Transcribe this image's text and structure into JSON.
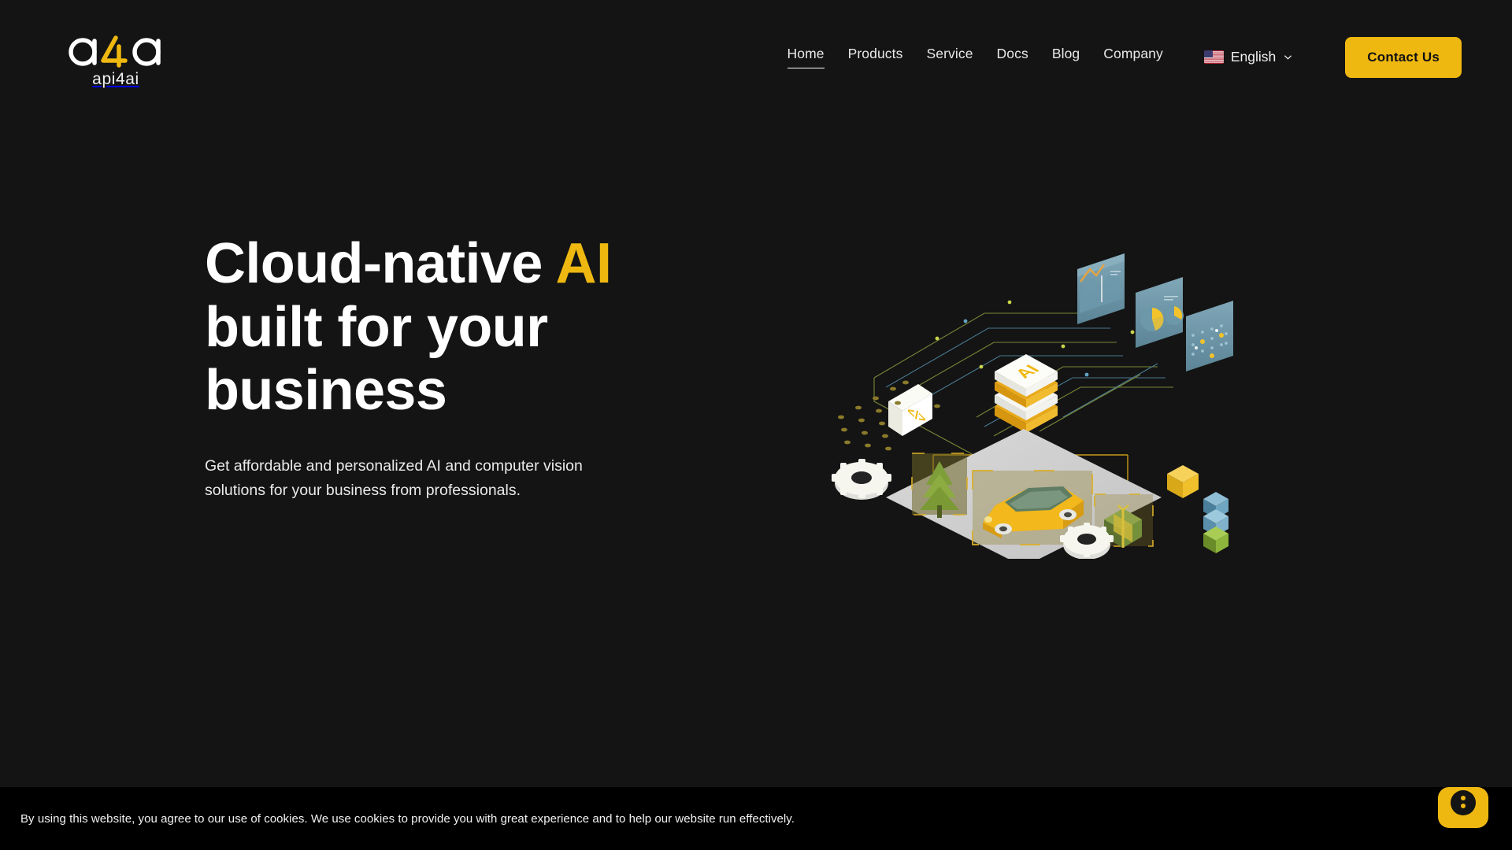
{
  "page": {
    "background_color": "#141414",
    "accent_color": "#EFB810",
    "text_color": "#FFFFFF"
  },
  "header": {
    "brand": {
      "mark_icon": "a4a-logo-icon",
      "wordmark": "api4ai"
    },
    "nav": [
      {
        "label": "Home",
        "active": true
      },
      {
        "label": "Products",
        "active": false
      },
      {
        "label": "Service",
        "active": false
      },
      {
        "label": "Docs",
        "active": false
      },
      {
        "label": "Blog",
        "active": false
      },
      {
        "label": "Company",
        "active": false
      }
    ],
    "language": {
      "flag_icon": "us-flag-icon",
      "label": "English",
      "chevron_icon": "chevron-down-icon"
    },
    "cta": {
      "label": "Contact Us",
      "background_color": "#EFB810",
      "text_color": "#121212"
    }
  },
  "hero": {
    "title_line1_pre": "Cloud-native ",
    "title_accent": "AI",
    "title_line2": "built for your",
    "title_line3": "business",
    "subtitle": "Get affordable and personalized AI and computer vision solutions for your business from professionals.",
    "illustration": {
      "name": "isometric-ai-computer-vision-illustration",
      "elements": [
        "ai-cube",
        "chart-panel",
        "pie-panel",
        "dot-grid-panel",
        "code-card",
        "dot-cloud",
        "gear-large",
        "gear-small",
        "scene-plane",
        "tree-object",
        "car-object",
        "gift-object",
        "yellow-cube",
        "cube-stack"
      ],
      "ai_cube_label": "AI",
      "code_card_label": "</>"
    }
  },
  "cookie_banner": {
    "message": "By using this website, you agree to our use of cookies. We use cookies to provide you with great experience and to help our website run effectively."
  },
  "chat_widget": {
    "icon": "chat-bubble-icon",
    "background_color": "#EFB810"
  }
}
